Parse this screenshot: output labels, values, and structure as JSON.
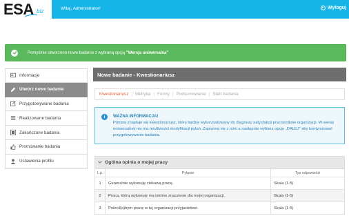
{
  "header": {
    "logo_main": "ESA",
    "logo_sub": "biz",
    "welcome": "Witaj, Administrator!",
    "logout_label": "Wyloguj",
    "bar_color": "#17b4e8"
  },
  "success_alert": {
    "text_before": "Pomyślnie utworzono nowe badanie z wybraną opcją ",
    "text_bold": "\"Wersja uniwersalna\"",
    "color": "#5cb85c"
  },
  "sidebar": {
    "items": [
      {
        "label": "Informacje",
        "icon": "arrow-left-icon"
      },
      {
        "label": "Utwórz nowe badanie",
        "icon": "pencil-icon",
        "active": true
      },
      {
        "label": "Przygotowywane badania",
        "icon": "edit-icon"
      },
      {
        "label": "Realizowane badania",
        "icon": "list-icon"
      },
      {
        "label": "Zakończone badania",
        "icon": "archive-icon"
      },
      {
        "label": "Promowanie badania",
        "icon": "thumbs-up-icon"
      },
      {
        "label": "Ustawienia profilu",
        "icon": "user-icon"
      }
    ]
  },
  "main": {
    "title": "Nowe badanie - Kwestionariusz",
    "steps": [
      "Kwestionariusz",
      "Metryka",
      "Formy",
      "Podsumowanie",
      "Start badania"
    ],
    "info": {
      "title": "WAŻNA INFORMACJA!",
      "text": "Poniżej znajduje się kwestionariusz, który będzie wykorzystywany do diagnozy satysfakcji pracowników organizacji. W wersji uniwersalnej nie ma możliwości modyfikacji pytań. Zapoznaj się z nimi a następnie wybierz opcję „DALEJ” aby kontynuować przygotowywanie badania."
    },
    "section": {
      "title": "Ogólna opinia o mojej pracy",
      "columns": [
        "L.p.",
        "Pytanie",
        "Typ odpowiedzi"
      ],
      "rows": [
        {
          "lp": "1",
          "question": "Generalnie wykonuję ciekawą pracę.",
          "type": "Skala (1-5)"
        },
        {
          "lp": "2",
          "question": "Praca, którą wykonuję ma istotne znaczenie dla mojej organizacji.",
          "type": "Skala (1-5)"
        },
        {
          "lp": "3",
          "question": "Polecił(a)bym pracę w tej organizacji przyjacielowi.",
          "type": "Skala (1-5)"
        }
      ]
    }
  }
}
